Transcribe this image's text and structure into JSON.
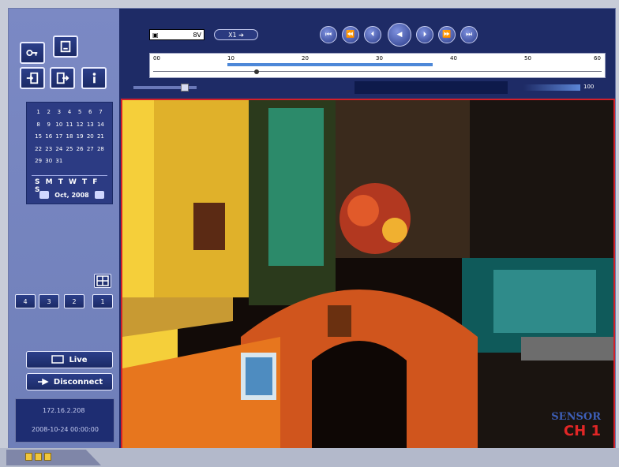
{
  "left_panel": {
    "calendar": {
      "days": [
        "1",
        "2",
        "3",
        "4",
        "5",
        "6",
        "7",
        "8",
        "9",
        "10",
        "11",
        "12",
        "13",
        "14",
        "15",
        "16",
        "17",
        "18",
        "19",
        "20",
        "21",
        "22",
        "23",
        "24",
        "25",
        "26",
        "27",
        "28",
        "29",
        "30",
        "31",
        "",
        "",
        "",
        ""
      ],
      "weekdays": "S M T W T F S",
      "month_label": "Oct, 2008"
    },
    "buttons": {
      "live": "Live",
      "disconnect": "Disconnect"
    },
    "channel_buttons": [
      "1",
      "2",
      "3",
      "4"
    ],
    "info": {
      "ip": "172.16.2.208",
      "datetime": "2008-10-24 00:00:00"
    }
  },
  "player": {
    "date_field": "8V",
    "speed_label": "X1",
    "timeline_ticks": [
      "00",
      "10",
      "20",
      "30",
      "40",
      "50",
      "60"
    ],
    "volume_label": "100",
    "channel_overlay": {
      "brand": "SENSOR",
      "channel": "CH 1"
    }
  },
  "colors": {
    "panel": "#1f2c68",
    "sidebar": "#7b89c4",
    "video_border": "#d2202a"
  }
}
